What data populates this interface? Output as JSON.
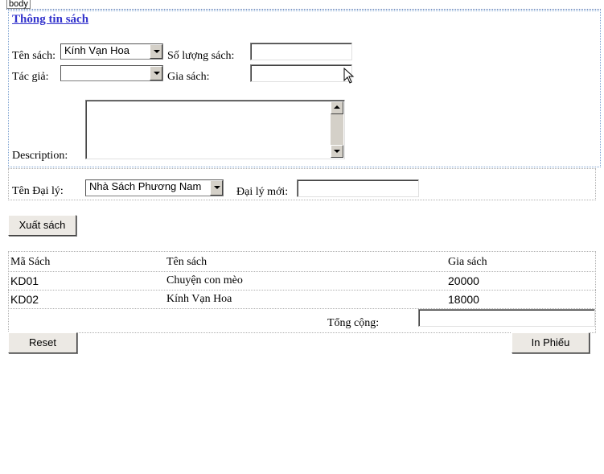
{
  "body_tag": "body",
  "book_info": {
    "title": "Thông tin sách",
    "book_name_label": "Tên sách:",
    "book_name_selected": "Kính Vạn Hoa",
    "quantity_label": "Số lượng sách:",
    "quantity_value": "",
    "author_label": "Tác giả:",
    "author_selected": "",
    "price_label": "Gia sách:",
    "price_value": "",
    "description_label": "Description:",
    "description_value": ""
  },
  "agent": {
    "agent_name_label": "Tên Đại lý:",
    "agent_selected": "Nhà Sách Phương Nam",
    "new_agent_label": "Đại lý mới:",
    "new_agent_value": ""
  },
  "export_button": "Xuất sách",
  "table": {
    "headers": [
      "Mã Sách",
      "Tên sách",
      "Gia sách"
    ],
    "rows": [
      [
        "KD01",
        "Chuyện con mèo",
        "20000"
      ],
      [
        "KD02",
        "Kính Vạn Hoa",
        "18000"
      ]
    ],
    "total_label": "Tổng cộng:",
    "total_value": ""
  },
  "reset_button": "Reset",
  "print_button": "In Phiếu"
}
